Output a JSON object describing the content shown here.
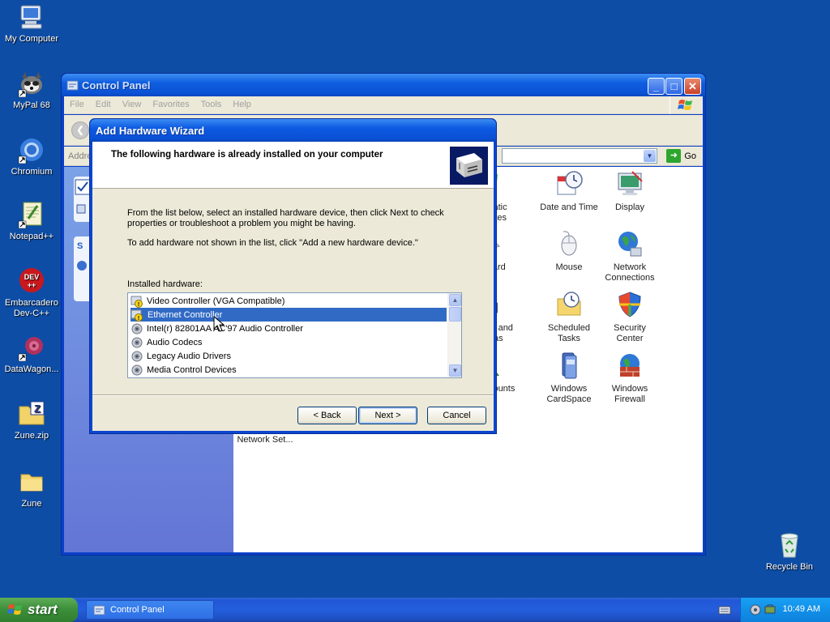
{
  "desktop": {
    "icons": [
      {
        "label": "My Computer",
        "icon": "my-computer-icon"
      },
      {
        "label": "MyPal 68",
        "icon": "mypal-icon"
      },
      {
        "label": "Chromium",
        "icon": "chromium-icon"
      },
      {
        "label": "Notepad++",
        "icon": "notepadpp-icon"
      },
      {
        "label": "Embarcadero Dev-C++",
        "icon": "devcpp-icon"
      },
      {
        "label": "DataWagon...",
        "icon": "datawagon-icon"
      },
      {
        "label": "Zune.zip",
        "icon": "zip-folder-icon"
      },
      {
        "label": "Zune",
        "icon": "folder-icon"
      },
      {
        "label": "Recycle Bin",
        "icon": "recycle-bin-icon"
      }
    ]
  },
  "control_panel": {
    "title": "Control Panel",
    "menu": [
      "File",
      "Edit",
      "View",
      "Favorites",
      "Tools",
      "Help"
    ],
    "address_label": "Addre",
    "go_label": "Go",
    "left_letter": "S",
    "items": [
      {
        "label": "utomatic\nUpdates",
        "icon": "automatic-updates-icon"
      },
      {
        "label": "Date and Time",
        "icon": "date-time-icon"
      },
      {
        "label": "Display",
        "icon": "display-icon"
      },
      {
        "label": "eyboard",
        "icon": "keyboard-icon"
      },
      {
        "label": "Mouse",
        "icon": "mouse-icon"
      },
      {
        "label": "Network\nConnections",
        "icon": "network-connections-icon"
      },
      {
        "label": "nners and\nameras",
        "icon": "scanners-cameras-icon"
      },
      {
        "label": "Scheduled\nTasks",
        "icon": "scheduled-tasks-icon"
      },
      {
        "label": "Security\nCenter",
        "icon": "security-center-icon"
      },
      {
        "label": "r Accounts",
        "icon": "user-accounts-icon"
      },
      {
        "label": "Windows\nCardSpace",
        "icon": "cardspace-icon"
      },
      {
        "label": "Windows\nFirewall",
        "icon": "firewall-icon"
      },
      {
        "label": "Wireless\nNetwork Set...",
        "icon": "wireless-network-icon"
      }
    ]
  },
  "wizard": {
    "title": "Add Hardware Wizard",
    "heading": "The following hardware is already installed on your computer",
    "instructions": "From the list below, select an installed hardware device, then click Next to check properties or troubleshoot a problem you might be having.",
    "add_note": "To add hardware not shown in the list, click \"Add a new hardware device.\"",
    "list_label": "Installed hardware:",
    "hardware": [
      {
        "name": "Video Controller (VGA Compatible)",
        "icon": "device-warning-icon",
        "selected": false
      },
      {
        "name": "Ethernet Controller",
        "icon": "device-warning-icon",
        "selected": true
      },
      {
        "name": "Intel(r) 82801AA AC'97 Audio Controller",
        "icon": "audio-device-icon",
        "selected": false
      },
      {
        "name": "Audio Codecs",
        "icon": "audio-device-icon",
        "selected": false
      },
      {
        "name": "Legacy Audio Drivers",
        "icon": "audio-device-icon",
        "selected": false
      },
      {
        "name": "Media Control Devices",
        "icon": "audio-device-icon",
        "selected": false
      }
    ],
    "buttons": {
      "back": "< Back",
      "next": "Next >",
      "cancel": "Cancel"
    }
  },
  "taskbar": {
    "start_label": "start",
    "task_button": "Control Panel",
    "clock": "10:49 AM"
  }
}
